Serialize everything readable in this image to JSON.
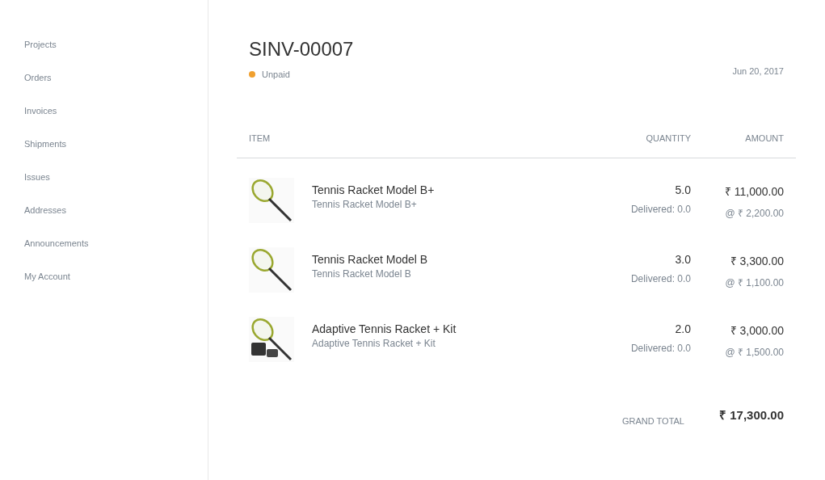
{
  "sidebar": {
    "items": [
      {
        "label": "Projects"
      },
      {
        "label": "Orders"
      },
      {
        "label": "Invoices"
      },
      {
        "label": "Shipments"
      },
      {
        "label": "Issues"
      },
      {
        "label": "Addresses"
      },
      {
        "label": "Announcements"
      },
      {
        "label": "My Account"
      }
    ]
  },
  "invoice": {
    "title": "SINV-00007",
    "status": {
      "label": "Unpaid",
      "color": "#f0a030"
    },
    "date": "Jun 20, 2017"
  },
  "table": {
    "columns": [
      "ITEM",
      "QUANTITY",
      "AMOUNT"
    ],
    "rows": [
      {
        "kind": "racket",
        "name": "Tennis Racket Model B+",
        "description": "Tennis Racket Model B+",
        "quantity": "5.0",
        "delivered": "Delivered: 0.0",
        "amount": "₹ 11,000.00",
        "rate": "@ ₹ 2,200.00"
      },
      {
        "kind": "racket",
        "name": "Tennis Racket Model B",
        "description": "Tennis Racket Model B",
        "quantity": "3.0",
        "delivered": "Delivered: 0.0",
        "amount": "₹ 3,300.00",
        "rate": "@ ₹ 1,100.00"
      },
      {
        "kind": "kit",
        "name": "Adaptive Tennis Racket + Kit",
        "description": "Adaptive Tennis Racket + Kit",
        "quantity": "2.0",
        "delivered": "Delivered: 0.0",
        "amount": "₹ 3,000.00",
        "rate": "@ ₹ 1,500.00"
      }
    ]
  },
  "grand_total": {
    "label": "GRAND TOTAL",
    "value": "₹ 17,300.00"
  }
}
